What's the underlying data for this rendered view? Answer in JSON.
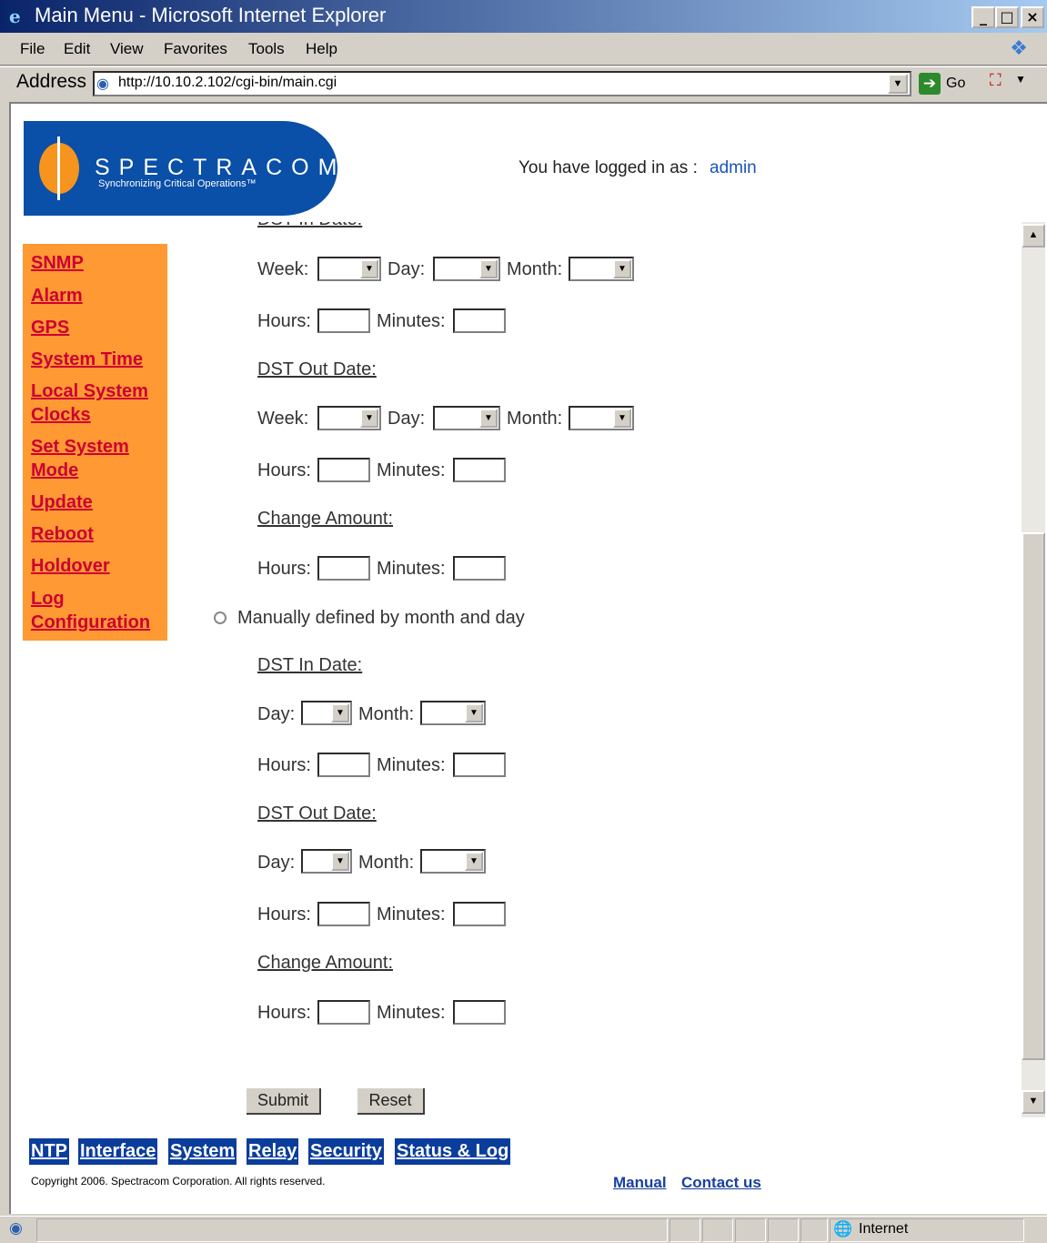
{
  "window": {
    "title": "Main Menu - Microsoft Internet Explorer",
    "min_btn": "_",
    "max_btn": "□",
    "close_btn": "×"
  },
  "menubar": {
    "items": [
      "File",
      "Edit",
      "View",
      "Favorites",
      "Tools",
      "Help"
    ]
  },
  "address": {
    "label": "Address",
    "url": "http://10.10.2.102/cgi-bin/main.cgi",
    "go_label": "Go"
  },
  "header": {
    "logo_text": "SPECTRACOM",
    "logo_sub": "Synchronizing Critical Operations™",
    "login_label": "You have logged in as :",
    "login_user": "admin"
  },
  "sidebar": {
    "items": [
      "SNMP",
      "Alarm",
      "GPS",
      "System Time",
      "Local System Clocks",
      "Set System Mode",
      "Update",
      "Reboot",
      "Holdover",
      "Log Configuration"
    ]
  },
  "form": {
    "partial_heading": "DST In Date:",
    "labels": {
      "week": "Week:",
      "day": "Day:",
      "month": "Month:",
      "hours": "Hours:",
      "minutes": "Minutes:"
    },
    "dst_out_date": "DST Out Date:",
    "change_amount": "Change Amount:",
    "radio_manual": "Manually defined by month and day",
    "dst_in_date": "DST In Date:",
    "submit": "Submit",
    "reset": "Reset"
  },
  "bottom_nav": {
    "tabs": [
      "NTP",
      "Interface",
      "System",
      "Relay",
      "Security",
      "Status & Log"
    ]
  },
  "footer": {
    "copyright": "Copyright 2006. Spectracom Corporation. All rights reserved.",
    "manual": "Manual",
    "contact": "Contact us"
  },
  "statusbar": {
    "zone": "Internet"
  },
  "colors": {
    "sidebar_bg": "#ff9933",
    "sidebar_link": "#cc0033",
    "nav_bg": "#0a3d9c",
    "logo_bg": "#0a4fa8"
  }
}
